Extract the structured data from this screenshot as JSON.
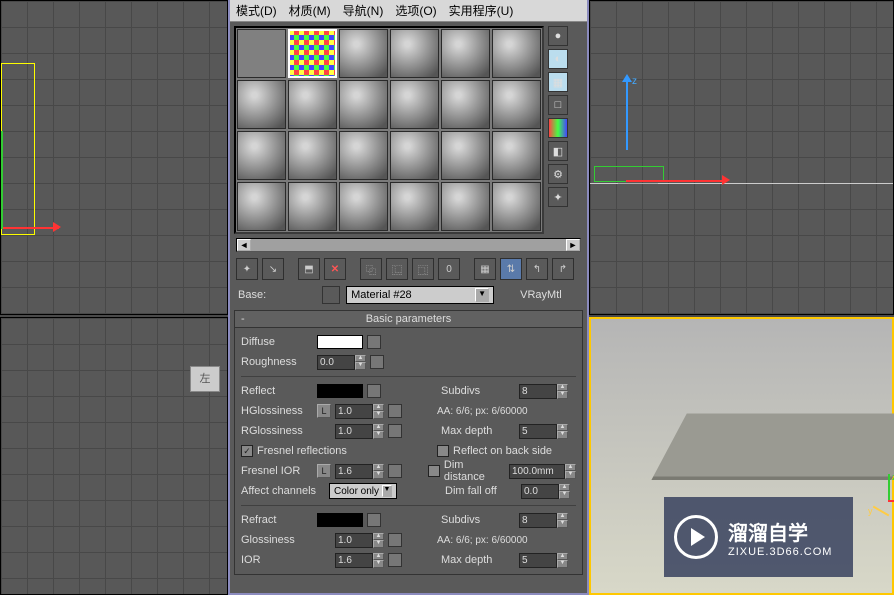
{
  "menu": {
    "mode": "模式(D)",
    "material": "材质(M)",
    "nav": "导航(N)",
    "options": "选项(O)",
    "util": "实用程序(U)"
  },
  "base_label": "Base:",
  "material_name": "Material #28",
  "material_type": "VRayMtl",
  "cube_label": "左",
  "axis_z": "z",
  "logo_cn": "溜溜自学",
  "logo_en": "ZIXUE.3D66.COM",
  "rollout": {
    "title": "Basic parameters",
    "dash": "-"
  },
  "params": {
    "diffuse_label": "Diffuse",
    "roughness_label": "Roughness",
    "roughness": "0.0",
    "reflect_label": "Reflect",
    "subdivs_label": "Subdivs",
    "subdivs_reflect": "8",
    "hgloss_label": "HGlossiness",
    "hgloss": "1.0",
    "aa_label": "AA: 6/6; px: 6/60000",
    "rgloss_label": "RGlossiness",
    "rgloss": "1.0",
    "maxdepth_label": "Max depth",
    "maxdepth_reflect": "5",
    "fresnel_label": "Fresnel reflections",
    "reflectback_label": "Reflect on back side",
    "fresnelior_label": "Fresnel IOR",
    "fresnelior": "1.6",
    "dimdist_label": "Dim distance",
    "dimdist": "100.0mm",
    "affect_label": "Affect channels",
    "affect_value": "Color only",
    "dimfall_label": "Dim fall off",
    "dimfall": "0.0",
    "refract_label": "Refract",
    "subdivs_refract": "8",
    "glossiness_label": "Glossiness",
    "glossiness": "1.0",
    "aa_label2": "AA: 6/6; px: 6/60000",
    "ior_label": "IOR",
    "ior": "1.6",
    "maxdepth_refract": "5",
    "L": "L"
  }
}
